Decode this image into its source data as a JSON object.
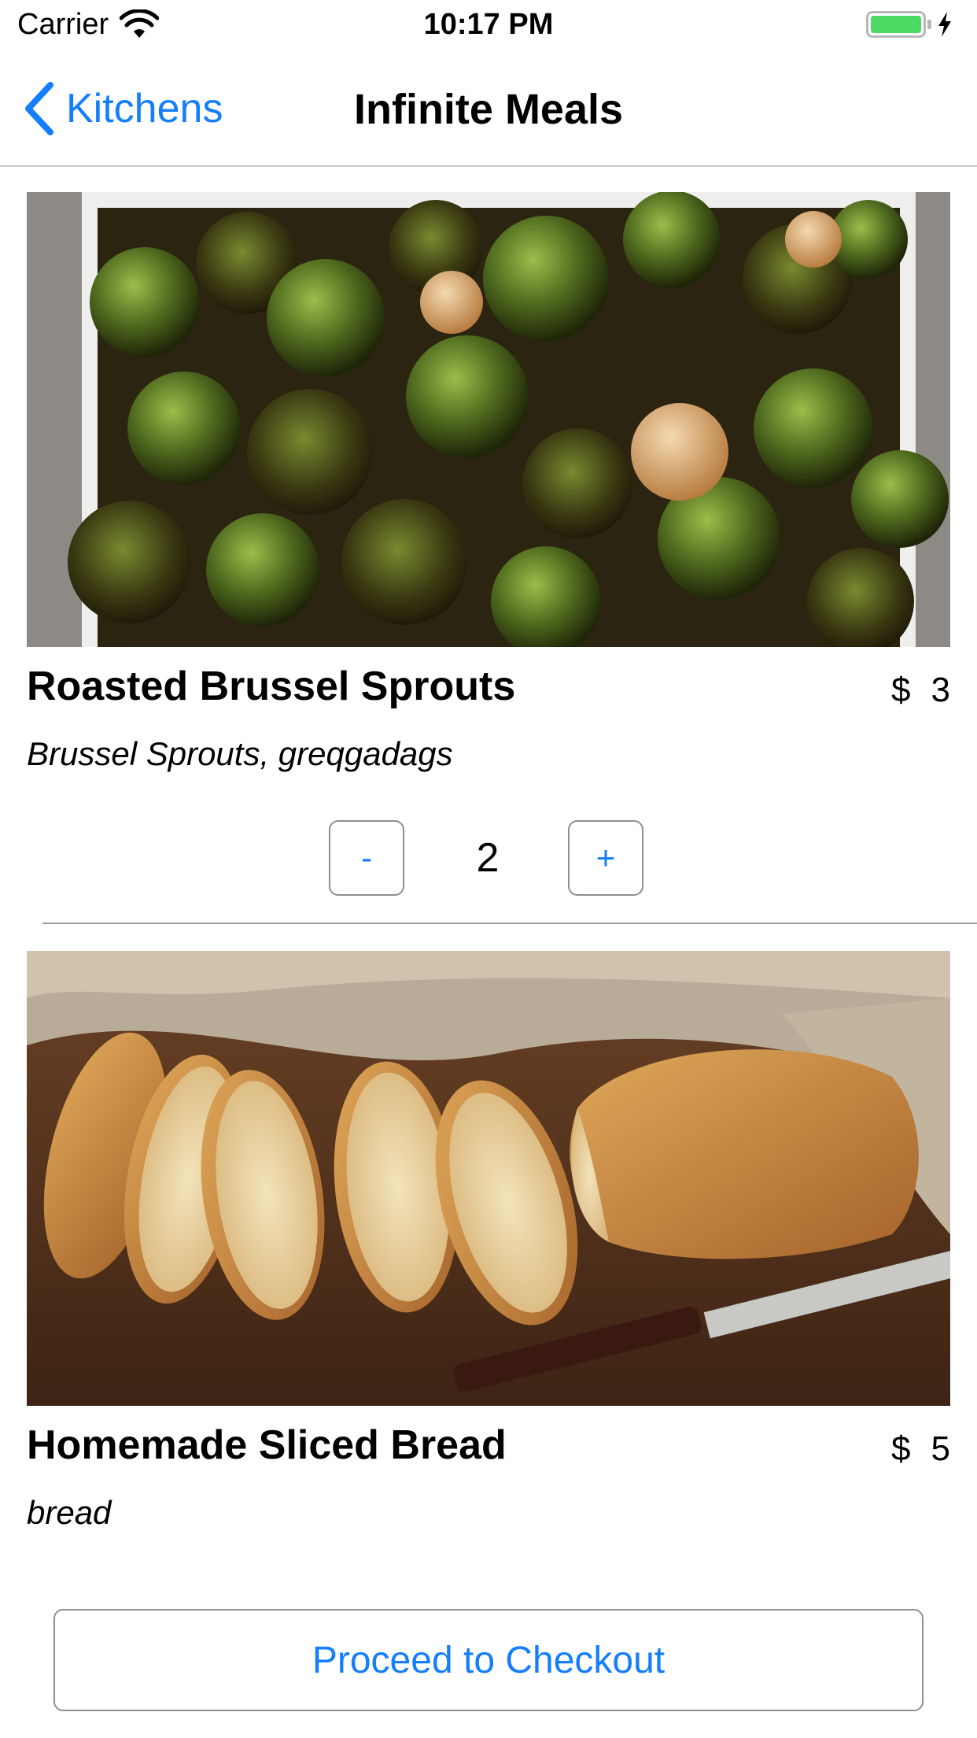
{
  "status_bar": {
    "carrier": "Carrier",
    "time": "10:17 PM",
    "battery_level": 1.0,
    "charging": true
  },
  "nav": {
    "back_label": "Kitchens",
    "title": "Infinite Meals"
  },
  "meals": [
    {
      "name": "Roasted Brussel Sprouts",
      "currency": "$",
      "price": "3",
      "description": "Brussel Sprouts, greqgadags",
      "quantity": "2",
      "decrement_label": "-",
      "increment_label": "+"
    },
    {
      "name": "Homemade Sliced Bread",
      "currency": "$",
      "price": "5",
      "description": "bread"
    }
  ],
  "checkout": {
    "label": "Proceed to Checkout"
  },
  "colors": {
    "accent": "#147efb",
    "battery": "#4cd964",
    "separator": "#c8c7cc"
  }
}
